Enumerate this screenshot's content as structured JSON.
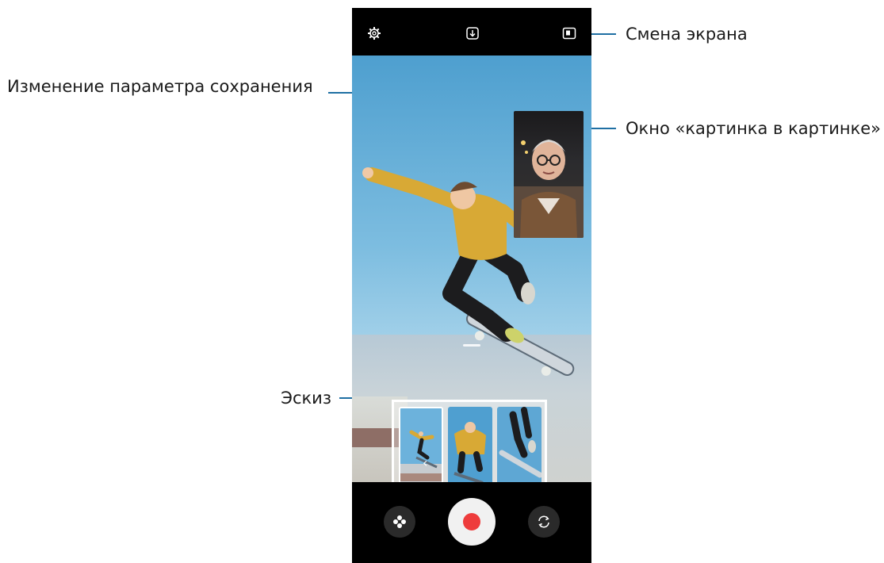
{
  "callouts": {
    "screen_switch": "Смена экрана",
    "save_option": "Изменение параметра сохранения",
    "pip_window": "Окно «картинка в картинке»",
    "thumbnail": "Эскиз"
  },
  "camera": {
    "top_bar": {
      "settings_icon": "gear-icon",
      "save_option_icon": "download-icon",
      "screen_switch_icon": "split-screen-icon"
    },
    "bottom_bar": {
      "effects_icon": "flower-effect-icon",
      "record_icon": "record-icon",
      "flip_icon": "camera-flip-icon"
    },
    "thumbnails_count_visible": 3,
    "colors": {
      "accent_line": "#1f6fa3",
      "record_red": "#ee3c3c",
      "jacket_yellow": "#d8a935"
    }
  }
}
